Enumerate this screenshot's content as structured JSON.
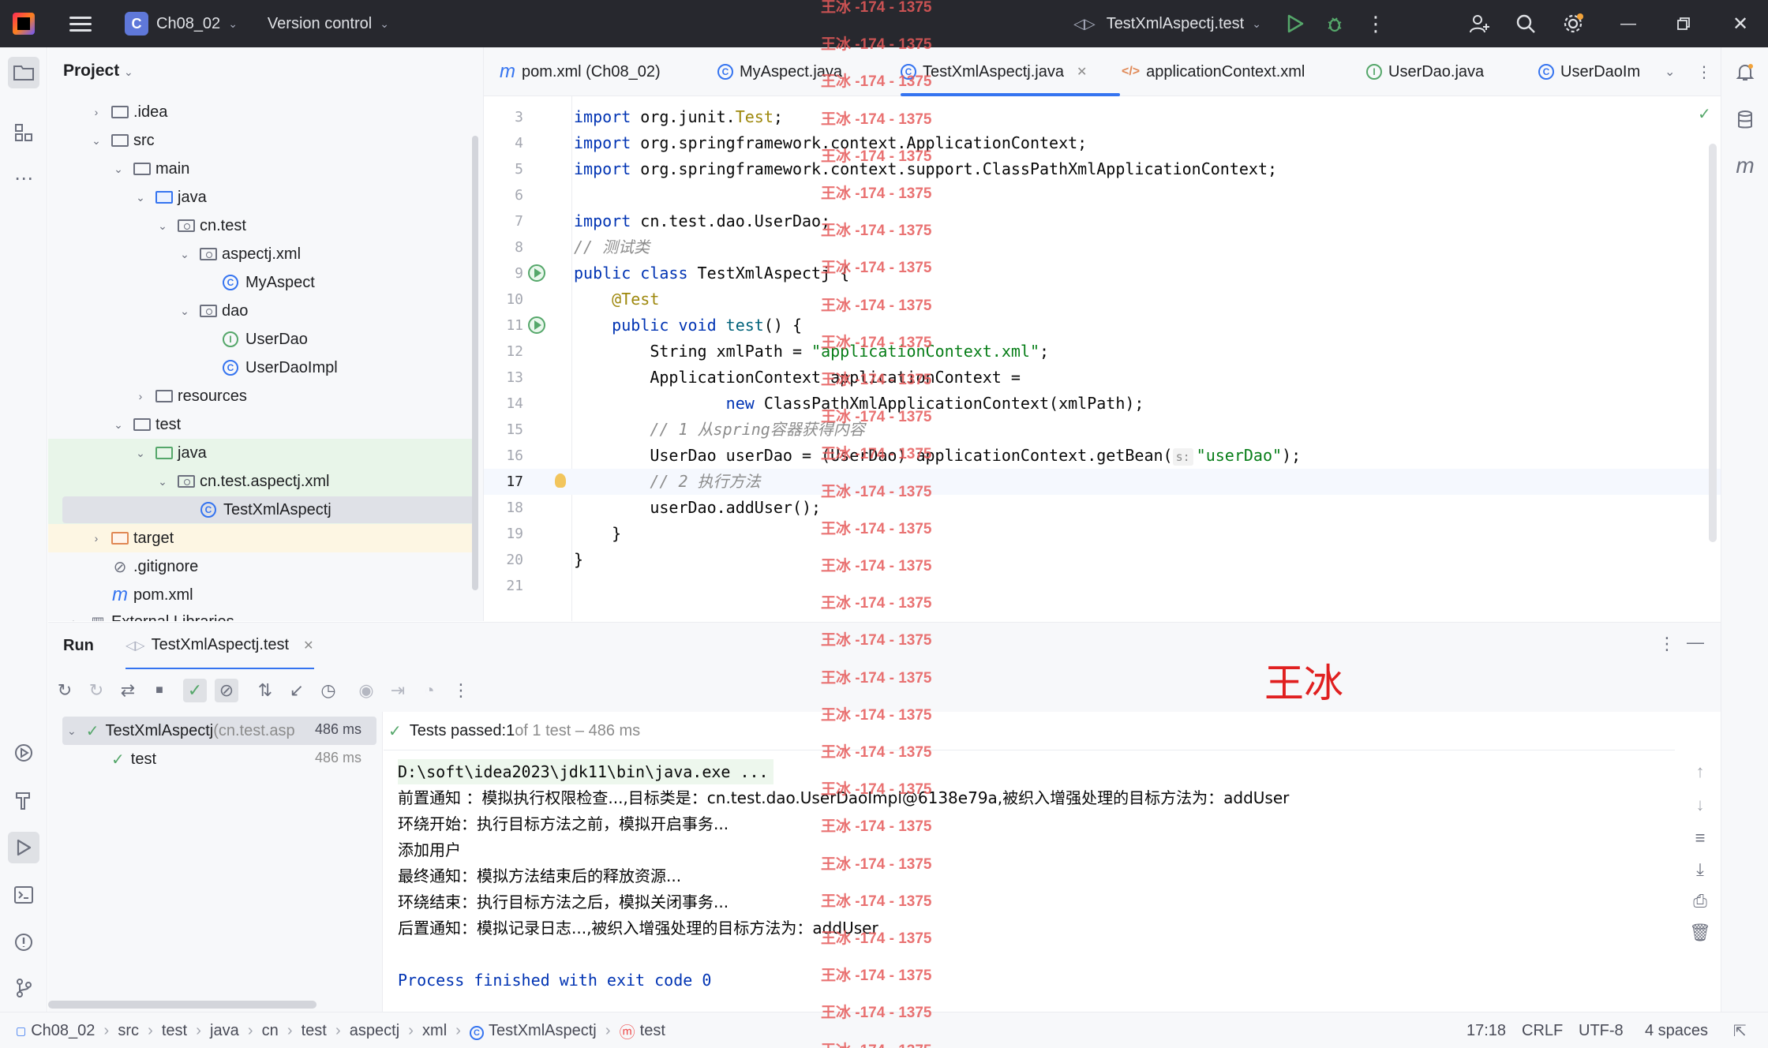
{
  "titlebar": {
    "project_badge": "C",
    "project_name": "Ch08_02",
    "vcs_label": "Version control",
    "run_config": "TestXmlAspectj.test"
  },
  "project_panel": {
    "title": "Project",
    "tree": [
      {
        "label": ".idea",
        "sub": ""
      },
      {
        "label": "src",
        "sub": ""
      },
      {
        "label": "main",
        "sub": ""
      },
      {
        "label": "java",
        "sub": ""
      },
      {
        "label": "cn.test",
        "sub": ""
      },
      {
        "label": "aspectj.xml",
        "sub": ""
      },
      {
        "label": "MyAspect",
        "sub": ""
      },
      {
        "label": "dao",
        "sub": ""
      },
      {
        "label": "UserDao",
        "sub": ""
      },
      {
        "label": "UserDaoImpl",
        "sub": ""
      },
      {
        "label": "resources",
        "sub": ""
      },
      {
        "label": "test",
        "sub": ""
      },
      {
        "label": "java",
        "sub": ""
      },
      {
        "label": "cn.test.aspectj.xml",
        "sub": ""
      },
      {
        "label": "TestXmlAspectj",
        "sub": ""
      },
      {
        "label": "target",
        "sub": ""
      },
      {
        "label": ".gitignore",
        "sub": ""
      },
      {
        "label": "pom.xml",
        "sub": ""
      },
      {
        "label": "External Libraries",
        "sub": ""
      }
    ]
  },
  "editor_tabs": [
    {
      "icon": "m",
      "label": "pom.xml (Ch08_02)"
    },
    {
      "icon": "C",
      "label": "MyAspect.java"
    },
    {
      "icon": "C",
      "label": "TestXmlAspectj.java"
    },
    {
      "icon": "</>",
      "label": "applicationContext.xml"
    },
    {
      "icon": "I",
      "label": "UserDao.java"
    },
    {
      "icon": "C",
      "label": "UserDaoIm"
    }
  ],
  "editor": {
    "line_numbers": [
      "3",
      "4",
      "5",
      "6",
      "7",
      "8",
      "9",
      "10",
      "11",
      "12",
      "13",
      "14",
      "15",
      "16",
      "17",
      "18",
      "19",
      "20",
      "21"
    ],
    "lines": [
      [
        "kw:import",
        "t: org.junit.",
        "ann:Test",
        "t:;"
      ],
      [
        "kw:import",
        "t: org.springframework.context.ApplicationContext;"
      ],
      [
        "kw:import",
        "t: org.springframework.context.support.ClassPathXmlApplicationContext;"
      ],
      [],
      [
        "kw:import",
        "t: cn.test.dao.UserDao;"
      ],
      [
        "cmt:// 测试类"
      ],
      [
        "kw:public class",
        "t: TestXmlAspectj {"
      ],
      [
        "t:    ",
        "ann:@Test"
      ],
      [
        "t:    ",
        "kw:public void",
        "t: ",
        "mth:test",
        "t:() {"
      ],
      [
        "t:        String xmlPath = ",
        "str:\"applicationContext.xml\"",
        "t:;"
      ],
      [
        "t:        ApplicationContext applicationContext ="
      ],
      [
        "t:                ",
        "kw:new",
        "t: ClassPathXmlApplicationContext(xmlPath);"
      ],
      [
        "t:        ",
        "cmt:// 1 从spring容器获得内容"
      ],
      [
        "t:        UserDao userDao = (UserDao) applicationContext.getBean(",
        "hint:s:",
        "str:\"userDao\"",
        "t:);"
      ],
      [
        "t:        ",
        "cmt:// 2 执行方法"
      ],
      [
        "t:        userDao.addUser();"
      ],
      [
        "t:    }"
      ],
      [
        "t:}"
      ],
      []
    ]
  },
  "run_panel": {
    "title": "Run",
    "tab_label": "TestXmlAspectj.test",
    "tree": [
      {
        "label": "TestXmlAspectj",
        "sub": " (cn.test.asp",
        "time": "486 ms"
      },
      {
        "label": "test",
        "sub": "",
        "time": "486 ms"
      }
    ],
    "status_bold": "Tests passed: ",
    "status_count": "1",
    "status_rest": " of 1 test – 486 ms",
    "console": [
      "D:\\soft\\idea2023\\jdk11\\bin\\java.exe ...",
      "前置通知 ：模拟执行权限检查...,目标类是：cn.test.dao.UserDaoImpl@6138e79a,被织入增强处理的目标方法为：addUser",
      "环绕开始：执行目标方法之前，模拟开启事务...",
      "添加用户",
      "最终通知：模拟方法结束后的释放资源...",
      "环绕结束：执行目标方法之后，模拟关闭事务...",
      "后置通知：模拟记录日志...,被织入增强处理的目标方法为：addUser",
      "",
      "Process finished with exit code 0"
    ]
  },
  "statusbar": {
    "breadcrumbs": [
      "Ch08_02",
      "src",
      "test",
      "java",
      "cn",
      "test",
      "aspectj",
      "xml",
      "TestXmlAspectj",
      "test"
    ],
    "position": "17:18",
    "line_sep": "CRLF",
    "encoding": "UTF-8",
    "indent": "4 spaces"
  },
  "watermark": {
    "repeat_text": "王冰 -174 - 1375",
    "big_text": "王冰"
  },
  "colors": {
    "accent": "#3574f0",
    "success": "#55a76a",
    "watermark": "#e65a5a"
  }
}
